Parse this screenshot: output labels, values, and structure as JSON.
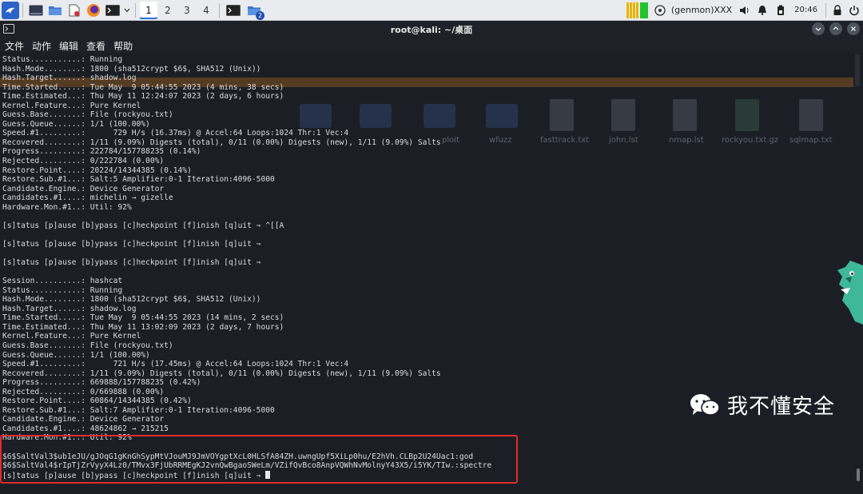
{
  "panel": {
    "workspaces": [
      "1",
      "2",
      "3",
      "4"
    ],
    "active_workspace": "1",
    "task_badge": "2",
    "genmon": "(genmon)XXX",
    "clock": "20:46"
  },
  "window": {
    "title": "root@kali: ~/桌面"
  },
  "menu": [
    "文件",
    "动作",
    "编辑",
    "查看",
    "帮助"
  ],
  "ghost_desktop": {
    "labels": [
      "ploit",
      "wfuzz",
      "fasttrack.txt",
      "john.lst",
      "nmap.lst",
      "rockyou.txt.gz",
      "sqlmap.txt"
    ]
  },
  "terminal": {
    "lines": [
      "Status...........: Running",
      "Hash.Mode........: 1800 (sha512crypt $6$, SHA512 (Unix))",
      "Hash.Target......: shadow.log",
      "Time.Started.....: Tue May  9 05:44:55 2023 (4 mins, 38 secs)",
      "Time.Estimated...: Thu May 11 12:24:07 2023 (2 days, 6 hours)",
      "Kernel.Feature...: Pure Kernel",
      "Guess.Base.......: File (rockyou.txt)",
      "Guess.Queue......: 1/1 (100.00%)",
      "Speed.#1.........:      729 H/s (16.37ms) @ Accel:64 Loops:1024 Thr:1 Vec:4",
      "Recovered........: 1/11 (9.09%) Digests (total), 0/11 (0.00%) Digests (new), 1/11 (9.09%) Salts",
      "Progress.........: 222784/157788235 (0.14%)",
      "Rejected.........: 0/222784 (0.00%)",
      "Restore.Point....: 20224/14344385 (0.14%)",
      "Restore.Sub.#1...: Salt:5 Amplifier:0-1 Iteration:4096-5000",
      "Candidate.Engine.: Device Generator",
      "Candidates.#1....: michelin → gizelle",
      "Hardware.Mon.#1..: Util: 92%",
      "",
      "[s]tatus [p]ause [b]ypass [c]heckpoint [f]inish [q]uit ⇒ ^[[A",
      "",
      "[s]tatus [p]ause [b]ypass [c]heckpoint [f]inish [q]uit ⇒",
      "",
      "[s]tatus [p]ause [b]ypass [c]heckpoint [f]inish [q]uit ⇒",
      "",
      "Session..........: hashcat",
      "Status...........: Running",
      "Hash.Mode........: 1800 (sha512crypt $6$, SHA512 (Unix))",
      "Hash.Target......: shadow.log",
      "Time.Started.....: Tue May  9 05:44:55 2023 (14 mins, 2 secs)",
      "Time.Estimated...: Thu May 11 13:02:09 2023 (2 days, 7 hours)",
      "Kernel.Feature...: Pure Kernel",
      "Guess.Base.......: File (rockyou.txt)",
      "Guess.Queue......: 1/1 (100.00%)",
      "Speed.#1.........:      721 H/s (17.45ms) @ Accel:64 Loops:1024 Thr:1 Vec:4",
      "Recovered........: 1/11 (9.09%) Digests (total), 0/11 (0.00%) Digests (new), 1/11 (9.09%) Salts",
      "Progress.........: 669888/157788235 (0.42%)",
      "Rejected.........: 0/669888 (0.00%)",
      "Restore.Point....: 60864/14344385 (0.42%)",
      "Restore.Sub.#1...: Salt:7 Amplifier:0-1 Iteration:4096-5000",
      "Candidate.Engine.: Device Generator",
      "Candidates.#1....: 48624862 → 215215",
      "Hardware.Mon.#1..: Util: 92%",
      "",
      "$6$SaltVal3$ub1eJU/gJOqG1gKnGhSypMtVJouMJ9JmVOYgptXcL0HLSfA84ZH.uwngUpf5XiLp0hu/E2hVh.CLBp2U24Uac1:god",
      "$6$SaltVal4$rIpTjZrVyyX4Lz0/TMvx3FjUbRRMEgKJ2vnQwBgaoSWeLm/VZifQvBco8AnpVQWhNvMolnyY43X5/i5YK/TIw.:spectre",
      "[s]tatus [p]ause [b]ypass [c]heckpoint [f]inish [q]uit ⇒ "
    ]
  },
  "watermark": {
    "text": "我不懂安全"
  },
  "colors": {
    "terminal_bg": "#1b1f25",
    "terminal_fg": "#d8dbe0",
    "highlight_row": "#6a4620",
    "red_box": "#e02b2b",
    "panel_bg": "#e9ebee"
  }
}
